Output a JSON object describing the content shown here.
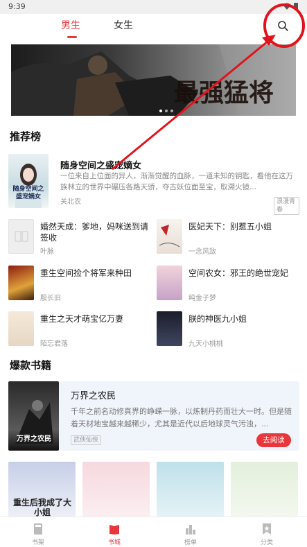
{
  "status_bar": {
    "time": "9:39"
  },
  "top_tabs": [
    {
      "label": "男生",
      "active": true
    },
    {
      "label": "女生",
      "active": false
    }
  ],
  "search": {
    "icon": "search-icon"
  },
  "banner": {
    "text": "最强猛将"
  },
  "recommend": {
    "title": "推荐榜",
    "featured": {
      "title": "随身空间之盛宠嫡女",
      "desc": "一位来自上位面的异人，渐渐觉醒的血脉，一道未知的钥匙，看他在这万族林立的世界中碾压各路天骄，夺古妖位面至宝，取溯火镜...",
      "author": "关北农",
      "tag": "浪漫青春",
      "cover_text": "随身空间之盛宠嫡女"
    },
    "items": [
      {
        "title": "婚然天成：爹地，妈咪送到请签收",
        "author": "叶脉",
        "cover": "placeholder"
      },
      {
        "title": "医妃天下：别惹五小姐",
        "author": "一念风敌",
        "cover": "ink"
      },
      {
        "title": "重生空间捡个将军来种田",
        "author": "殷长旧",
        "cover": "warm"
      },
      {
        "title": "空间农女：邪王的绝世宠妃",
        "author": "纯金子梦",
        "cover": "pink"
      },
      {
        "title": "重生之天才萌宝亿万妻",
        "author": "陌忘君落",
        "cover": "light"
      },
      {
        "title": "朕的神医九小姐",
        "author": "九天小桃桃",
        "cover": "dark"
      }
    ]
  },
  "hot": {
    "title": "爆款书籍",
    "book": {
      "title": "万界之农民",
      "desc": "千年之前名动修真界的峥嵘一脉，以炼制丹药而壮大一时。但是随着天材地宝越来越稀少，尤其是近代以后地球灵气污浊，...",
      "tag": "武侠仙侠",
      "button": "去阅读",
      "cover_text": "万界之农民"
    }
  },
  "bottom_covers": [
    {
      "text": "重生后我成了大小姐"
    },
    {
      "text": ""
    },
    {
      "text": ""
    },
    {
      "text": ""
    }
  ],
  "bottom_nav": [
    {
      "label": "书架",
      "icon": "bookshelf-icon",
      "active": false
    },
    {
      "label": "书城",
      "icon": "bookstore-icon",
      "active": true
    },
    {
      "label": "榜单",
      "icon": "ranking-icon",
      "active": false
    },
    {
      "label": "分类",
      "icon": "category-icon",
      "active": false
    }
  ],
  "colors": {
    "accent": "#e8363c",
    "annotation": "#e0141c"
  }
}
